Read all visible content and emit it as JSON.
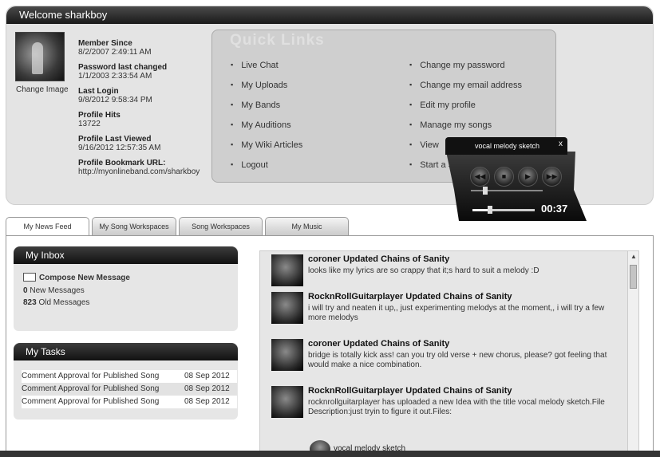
{
  "header": {
    "welcome": "Welcome sharkboy"
  },
  "profile": {
    "change_image": "Change Image",
    "fields": [
      {
        "label": "Member Since",
        "value": "8/2/2007 2:49:11 AM"
      },
      {
        "label": "Password last changed",
        "value": "1/1/2003 2:33:54 AM"
      },
      {
        "label": "Last Login",
        "value": "9/8/2012 9:58:34 PM"
      },
      {
        "label": "Profile Hits",
        "value": "13722"
      },
      {
        "label": "Profile Last Viewed",
        "value": "9/16/2012 12:57:35 AM"
      },
      {
        "label": "Profile Bookmark URL:",
        "value": "http://myonlineband.com/sharkboy"
      }
    ]
  },
  "quick_links": {
    "title": "Quick Links",
    "left": [
      "Live Chat",
      "My Uploads",
      "My Bands",
      "My Auditions",
      "My Wiki Articles",
      "Logout"
    ],
    "right": [
      "Change my password",
      "Change my email address",
      "Edit my profile",
      "Manage my songs",
      "View",
      "Start a S"
    ]
  },
  "player": {
    "title": "vocal melody sketch",
    "close": "x",
    "time": "00:37",
    "progress": 0.28,
    "volume": 0.2,
    "icons": [
      "rewind-icon",
      "stop-icon",
      "play-icon",
      "forward-icon"
    ]
  },
  "tabs": [
    "My News Feed",
    "My Song Workspaces",
    "Song Workspaces",
    "My Music"
  ],
  "inbox": {
    "title": "My Inbox",
    "compose": "Compose New Message",
    "new_count": "0",
    "new_label": "New Messages",
    "old_count": "823",
    "old_label": "Old Messages"
  },
  "tasks": {
    "title": "My Tasks",
    "rows": [
      {
        "name": "Comment Approval for Published Song",
        "date": "08 Sep 2012"
      },
      {
        "name": "Comment Approval for Published Song",
        "date": "08 Sep 2012"
      },
      {
        "name": "Comment Approval for Published Song",
        "date": "08 Sep 2012"
      }
    ]
  },
  "feed": [
    {
      "title": "coroner Updated Chains of Sanity",
      "text": "looks like my lyrics are so crappy that it;s hard to suit a melody :D"
    },
    {
      "title": "RocknRollGuitarplayer Updated Chains of Sanity",
      "text": "i will try and neaten it up,, just experimenting melodys at the moment,, i will try a few more melodys"
    },
    {
      "title": "coroner Updated Chains of Sanity",
      "text": "bridge is totally kick ass! can you try old verse + new chorus, please? got feeling that would make a nice combination."
    },
    {
      "title": "RocknRollGuitarplayer Updated Chains of Sanity",
      "text": "rocknrollguitarplayer has uploaded a new Idea with the title vocal melody sketch.File Description:just tryin to figure it out.Files:",
      "attachment": "vocal melody sketch"
    }
  ]
}
